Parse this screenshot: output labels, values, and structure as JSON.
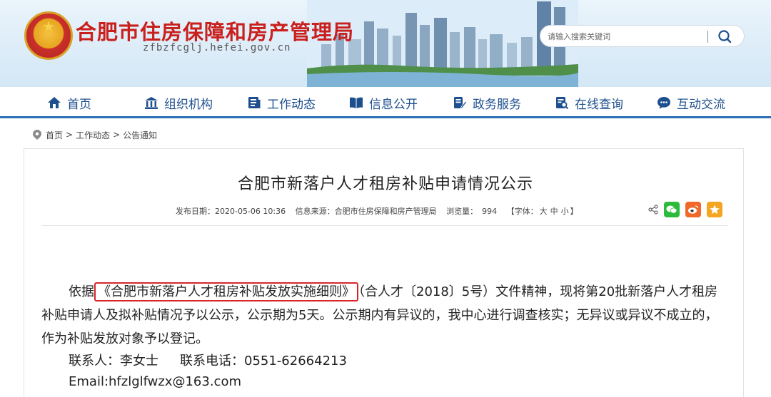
{
  "header": {
    "site_title": "合肥市住房保障和房产管理局",
    "site_domain": "zfbzfcglj.hefei.gov.cn",
    "search_placeholder": "请输入搜索关键词"
  },
  "nav": {
    "items": [
      {
        "label": "首页",
        "icon": "home-icon"
      },
      {
        "label": "组织机构",
        "icon": "building-icon"
      },
      {
        "label": "工作动态",
        "icon": "news-icon"
      },
      {
        "label": "信息公开",
        "icon": "book-icon"
      },
      {
        "label": "政务服务",
        "icon": "edit-doc-icon"
      },
      {
        "label": "在线查询",
        "icon": "search-doc-icon"
      },
      {
        "label": "互动交流",
        "icon": "chat-icon"
      }
    ]
  },
  "breadcrumb": {
    "home": "首页",
    "section": "工作动态",
    "current": "公告通知",
    "separator": ">"
  },
  "article": {
    "title": "合肥市新落户人才租房补贴申请情况公示",
    "publish_date": "发布日期：2020-05-06 10:36",
    "source": "信息来源：合肥市住房保障和房产管理局",
    "views_label": "浏览量：",
    "views": "994",
    "font_label": "【字体：",
    "font_large": "大",
    "font_medium": "中",
    "font_small": "小",
    "font_close": "】",
    "para1_prefix": "依据",
    "para1_highlight": "《合肥市新落户人才租房补贴发放实施细则》",
    "para1_rest": "（合人才〔2018〕5号）文件精神，现将第20批新落户人才租房补贴申请人及拟补贴情况予以公示，公示期为5天。公示期内有异议的，我中心进行调查核实；无异议或异议不成立的，作为补贴发放对象予以登记。",
    "contact_person": "联系人：李女士",
    "contact_phone": "联系电话：0551-62664213",
    "email": "Email:hfzlglfwzx@163.com"
  },
  "colors": {
    "title_red": "#c9201d",
    "nav_blue": "#1d4f8f",
    "nav_border": "#2a6fb6",
    "highlight_red": "#d6262c",
    "wechat_green": "#2dbb3e",
    "weibo_orange": "#f0682a",
    "qzone_yellow": "#f4a521"
  }
}
